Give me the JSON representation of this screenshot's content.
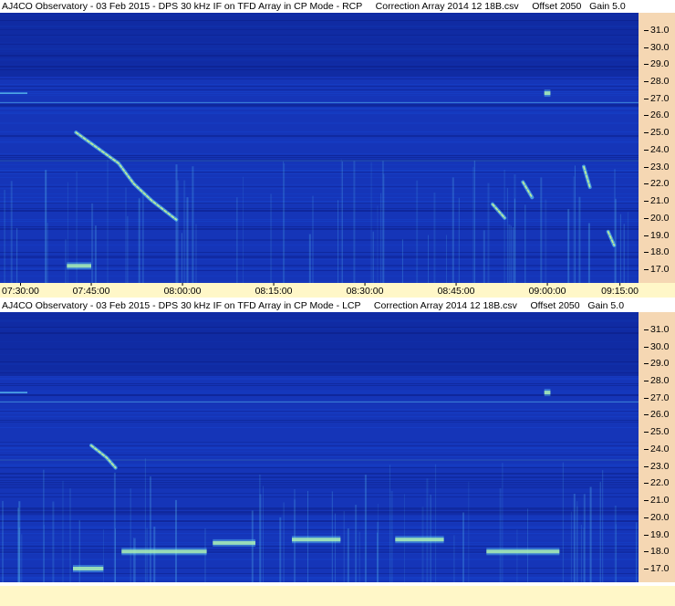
{
  "chart_data": [
    {
      "type": "heatmap",
      "title": "AJ4CO Observatory - 03 Feb 2015 - DPS 30 kHz IF on TFD Array in CP Mode - RCP     Correction Array 2014 12 18B.csv     Offset 2050   Gain 5.0",
      "y_ticks": [
        "31.0",
        "30.0",
        "29.0",
        "28.0",
        "27.0",
        "26.0",
        "25.0",
        "24.0",
        "23.0",
        "22.0",
        "21.0",
        "20.0",
        "19.0",
        "18.0",
        "17.0"
      ],
      "ylim": [
        16.2,
        32.0
      ],
      "x_ticks": [
        "07:30:00",
        "07:45:00",
        "08:00:00",
        "08:15:00",
        "08:30:00",
        "08:45:00",
        "09:00:00",
        "09:15:00"
      ],
      "xlim": [
        "07:30:00",
        "09:15:00"
      ],
      "features": [
        {
          "kind": "burst",
          "points": [
            [
              "07:42:30",
              25.0
            ],
            [
              "07:46:00",
              24.1
            ],
            [
              "07:49:30",
              23.2
            ],
            [
              "07:52:00",
              22.0
            ],
            [
              "07:55:00",
              21.0
            ],
            [
              "07:59:00",
              19.9
            ]
          ]
        },
        {
          "kind": "burst",
          "points": [
            [
              "08:51:00",
              20.8
            ],
            [
              "08:53:00",
              20.0
            ]
          ]
        },
        {
          "kind": "burst",
          "points": [
            [
              "08:56:00",
              22.1
            ],
            [
              "08:57:30",
              21.2
            ]
          ]
        },
        {
          "kind": "burst",
          "points": [
            [
              "09:06:00",
              23.0
            ],
            [
              "09:07:00",
              21.8
            ]
          ]
        },
        {
          "kind": "burst",
          "points": [
            [
              "09:10:00",
              19.2
            ],
            [
              "09:11:00",
              18.4
            ]
          ]
        },
        {
          "kind": "patch",
          "points": [
            [
              "07:41:00",
              17.2
            ],
            [
              "07:45:00",
              17.2
            ]
          ]
        },
        {
          "kind": "patch",
          "points": [
            [
              "08:59:30",
              27.3
            ],
            [
              "09:00:30",
              27.3
            ]
          ]
        }
      ]
    },
    {
      "type": "heatmap",
      "title": "AJ4CO Observatory - 03 Feb 2015 - DPS 30 kHz IF on TFD Array in CP Mode - LCP     Correction Array 2014 12 18B.csv     Offset 2050   Gain 5.0",
      "y_ticks": [
        "31.0",
        "30.0",
        "29.0",
        "28.0",
        "27.0",
        "26.0",
        "25.0",
        "24.0",
        "23.0",
        "22.0",
        "21.0",
        "20.0",
        "19.0",
        "18.0",
        "17.0"
      ],
      "ylim": [
        16.2,
        32.0
      ],
      "x_ticks": [],
      "xlim": [
        "07:30:00",
        "09:15:00"
      ],
      "features": [
        {
          "kind": "burst",
          "points": [
            [
              "07:45:00",
              24.2
            ],
            [
              "07:47:30",
              23.5
            ],
            [
              "07:49:00",
              22.9
            ]
          ]
        },
        {
          "kind": "patch",
          "points": [
            [
              "07:42:00",
              17.0
            ],
            [
              "07:47:00",
              17.0
            ]
          ]
        },
        {
          "kind": "patch",
          "points": [
            [
              "07:50:00",
              18.0
            ],
            [
              "08:04:00",
              18.0
            ]
          ]
        },
        {
          "kind": "patch",
          "points": [
            [
              "08:05:00",
              18.5
            ],
            [
              "08:12:00",
              18.5
            ]
          ]
        },
        {
          "kind": "patch",
          "points": [
            [
              "08:18:00",
              18.7
            ],
            [
              "08:26:00",
              18.7
            ]
          ]
        },
        {
          "kind": "patch",
          "points": [
            [
              "08:35:00",
              18.7
            ],
            [
              "08:43:00",
              18.7
            ]
          ]
        },
        {
          "kind": "patch",
          "points": [
            [
              "08:50:00",
              18.0
            ],
            [
              "09:02:00",
              18.0
            ]
          ]
        },
        {
          "kind": "patch",
          "points": [
            [
              "08:59:30",
              27.3
            ],
            [
              "09:00:30",
              27.3
            ]
          ]
        }
      ]
    }
  ],
  "colors": {
    "plot_bg": "#1535b8",
    "plot_band_dark": "#0c1f8a",
    "plot_band_mid": "#1642cc",
    "burst": "#6fe7ff",
    "burst_hot": "#d6ff8a",
    "y_axis_bg": "#f5d7b3",
    "x_axis_bg": "#fff7c8"
  }
}
